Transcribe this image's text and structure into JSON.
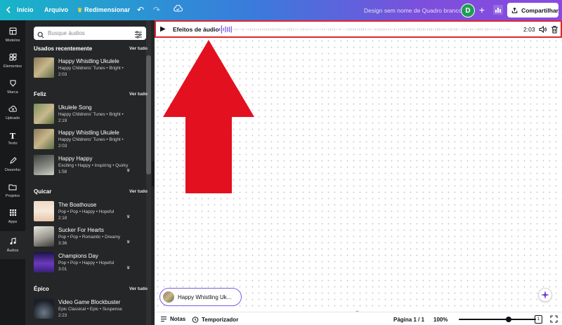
{
  "topbar": {
    "home_label": "Início",
    "file_label": "Arquivo",
    "resize_label": "Redimensionar",
    "document_name": "Design sem nome de Quadro branco",
    "avatar_letter": "D",
    "share_label": "Compartilhar",
    "gradient_start": "#18b4c8",
    "gradient_end": "#8a4ae0"
  },
  "rail": [
    {
      "label": "Modelos",
      "icon": "templates-icon"
    },
    {
      "label": "Elementos",
      "icon": "elements-icon"
    },
    {
      "label": "Marca",
      "icon": "brand-icon"
    },
    {
      "label": "Uploads",
      "icon": "upload-icon"
    },
    {
      "label": "Texto",
      "icon": "text-icon"
    },
    {
      "label": "Desenho",
      "icon": "draw-icon"
    },
    {
      "label": "Projetos",
      "icon": "folder-icon"
    },
    {
      "label": "Apps",
      "icon": "apps-icon"
    },
    {
      "label": "Áudios",
      "icon": "music-icon"
    }
  ],
  "panel": {
    "search_placeholder": "Busque áudios",
    "sections": [
      {
        "title": "Usados recentemente",
        "see_all": "Ver tudo",
        "tracks": [
          {
            "title": "Happy Whistling Ukulele",
            "meta": "Happy Childrens' Tunes • Bright •",
            "duration": "2:03"
          }
        ]
      },
      {
        "title": "Feliz",
        "see_all": "Ver tudo",
        "tracks": [
          {
            "title": "Ukulele Song",
            "meta": "Happy Childrens' Tunes • Bright •",
            "duration": "2:19"
          },
          {
            "title": "Happy Whistling Ukulele",
            "meta": "Happy Childrens' Tunes • Bright •",
            "duration": "2:03"
          },
          {
            "title": "Happy Happy",
            "meta": "Exciting • Happy • Inspiring • Quirky",
            "duration": "1:58"
          }
        ]
      },
      {
        "title": "Quicar",
        "see_all": "Ver tudo",
        "tracks": [
          {
            "title": "The Boathouse",
            "meta": "Pop • Pop • Happy • Hopeful",
            "duration": "2:18"
          },
          {
            "title": "Sucker For Hearts",
            "meta": "Pop • Pop • Romantic • Dreamy",
            "duration": "3:36"
          },
          {
            "title": "Champions Day",
            "meta": "Pop • Pop • Happy • Hopeful",
            "duration": "3:01"
          }
        ]
      },
      {
        "title": "Épico",
        "see_all": "Ver tudo",
        "tracks": [
          {
            "title": "Video Game Blockbuster",
            "meta": "Epic Classical • Epic • Suspense",
            "duration": "2:23"
          }
        ]
      }
    ]
  },
  "audio_bar": {
    "label": "Efeitos de áudio",
    "duration": "2:03",
    "highlight_color": "#e0262d",
    "wave_color": "#7d5ce4"
  },
  "audio_chip": {
    "label": "Happy Whistling Uk..."
  },
  "bottombar": {
    "notes_label": "Notas",
    "timer_label": "Temporizador",
    "page_label": "Página 1 / 1",
    "zoom_label": "100%",
    "zoom_percent": 100,
    "pages_count": "1"
  },
  "annotation": {
    "arrow_color": "#e3101f"
  }
}
